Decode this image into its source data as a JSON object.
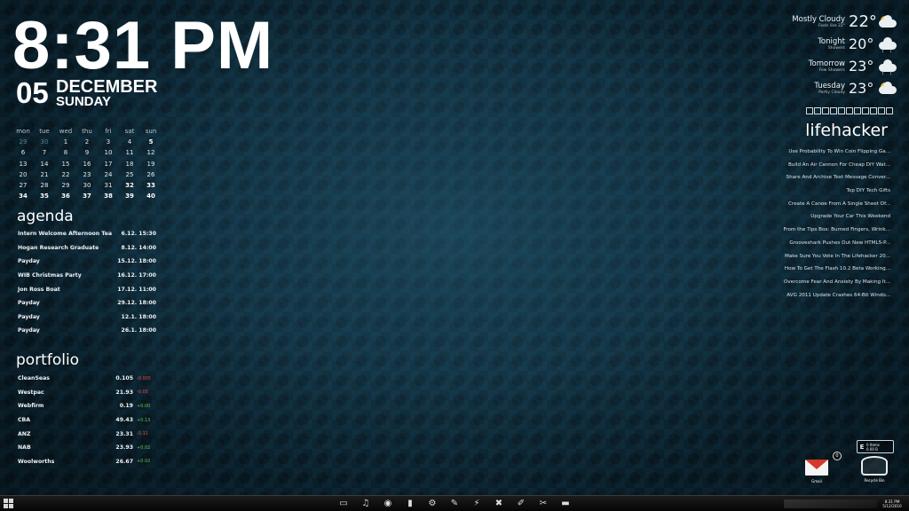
{
  "clock": {
    "time": "8:31 PM",
    "day": "05",
    "month": "DECEMBER",
    "weekday": "SUNDAY"
  },
  "calendar": {
    "headers": [
      "mon",
      "tue",
      "wed",
      "thu",
      "fri",
      "sat",
      "sun"
    ],
    "weeks": [
      [
        "29",
        "30",
        "1",
        "2",
        "3",
        "4",
        "5"
      ],
      [
        "6",
        "7",
        "8",
        "9",
        "10",
        "11",
        "12"
      ],
      [
        "13",
        "14",
        "15",
        "16",
        "17",
        "18",
        "19"
      ],
      [
        "20",
        "21",
        "22",
        "23",
        "24",
        "25",
        "26"
      ],
      [
        "27",
        "28",
        "29",
        "30",
        "31",
        "32",
        "33"
      ],
      [
        "34",
        "35",
        "36",
        "37",
        "38",
        "39",
        "40"
      ]
    ]
  },
  "agenda": {
    "title": "agenda",
    "items": [
      {
        "name": "Intern Welcome Afternoon Tea",
        "when": "6.12. 15:30"
      },
      {
        "name": "Hogan Research Graduate",
        "when": "8.12. 14:00"
      },
      {
        "name": "Payday",
        "when": "15.12. 18:00"
      },
      {
        "name": "WIB Christmas Party",
        "when": "16.12. 17:00"
      },
      {
        "name": "Jon Ross Boat",
        "when": "17.12. 11:00"
      },
      {
        "name": "Payday",
        "when": "29.12. 18:00"
      },
      {
        "name": "Payday",
        "when": "12.1. 18:00"
      },
      {
        "name": "Payday",
        "when": "26.1. 18:00"
      }
    ]
  },
  "portfolio": {
    "title": "portfolio",
    "items": [
      {
        "name": "CleanSeas",
        "price": "0.105",
        "change": "-0.005",
        "status": "neg"
      },
      {
        "name": "Westpac",
        "price": "21.93",
        "change": "-0.05",
        "status": "neg"
      },
      {
        "name": "Webfirm",
        "price": "0.19",
        "change": "+0.00",
        "status": "pos"
      },
      {
        "name": "CBA",
        "price": "49.43",
        "change": "+0.13",
        "status": "pos"
      },
      {
        "name": "ANZ",
        "price": "23.31",
        "change": "-0.11",
        "status": "neg"
      },
      {
        "name": "NAB",
        "price": "23.93",
        "change": "+0.02",
        "status": "pos"
      },
      {
        "name": "Woolworths",
        "price": "26.67",
        "change": "+0.02",
        "status": "pos"
      }
    ],
    "colors": {
      "neg": "#e04848",
      "pos": "#5fc44e"
    }
  },
  "weather": [
    {
      "label": "Mostly Cloudy",
      "sub": "Feels like 22°",
      "temp": "22°",
      "icon": "partly-cloudy-icon"
    },
    {
      "label": "Tonight",
      "sub": "Showers",
      "temp": "20°",
      "icon": "showers-icon"
    },
    {
      "label": "Tomorrow",
      "sub": "Few Showers",
      "temp": "23°",
      "icon": "showers-icon"
    },
    {
      "label": "Tuesday",
      "sub": "Partly Cloudy",
      "temp": "23°",
      "icon": "partly-cloudy-icon"
    }
  ],
  "lifehacker": {
    "title": "lifehacker",
    "items": [
      "Use Probability To Win Coin Flipping Ga...",
      "Build An Air Cannon For Cheap DIY Wat...",
      "Share And Archive Text Message Conver...",
      "Top DIY Tech Gifts",
      "Create A Canoe From A Single Sheet Of...",
      "Upgrade Your Car This Weekend",
      "From the Tips Box: Burned Fingers, Wrink...",
      "Grooveshark Pushes Out New HTML5-P...",
      "Make Sure You Vote In The Lifehacker 20...",
      "How To Get The Flash 10.2 Beta Working...",
      "Overcome Fear And Anxiety By Making It...",
      "AVG 2011 Update Crashes 64-Bit Windo..."
    ]
  },
  "desktop": {
    "gmail_label": "Gmail",
    "gmail_count": "0",
    "recycle_label": "Recycle Bin",
    "bin_letter": "E",
    "bin_items": "0 Items",
    "bin_size": "0.00 B"
  },
  "taskbar": {
    "icons": [
      "monitor-icon",
      "music-icon",
      "chrome-icon",
      "files-icon",
      "steam-icon",
      "feather-icon",
      "winamp-icon",
      "xfire-icon",
      "pencil-icon",
      "paint-icon",
      "folder-icon"
    ],
    "clock_time": "8:31 PM",
    "clock_date": "5/12/2010"
  }
}
